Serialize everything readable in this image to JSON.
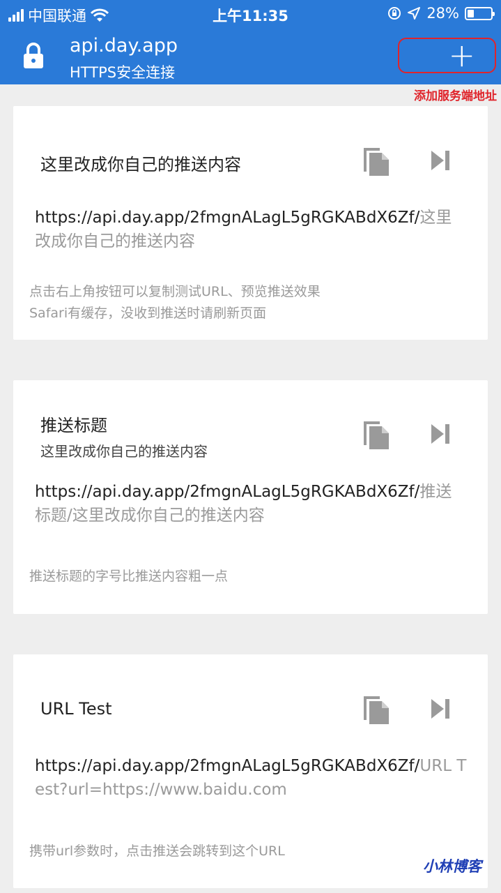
{
  "status_bar": {
    "carrier": "中国联通",
    "time": "上午11:35",
    "battery": "28%",
    "battery_level": 0.28
  },
  "header": {
    "domain": "api.day.app",
    "security": "HTTPS安全连接",
    "add_label": "+",
    "add_annotation": "添加服务端地址"
  },
  "cards": [
    {
      "title": "这里改成你自己的推送内容",
      "subtitle": "",
      "url_base": "https://api.day.app/2fmgnALagL5gRGKABdX6Zf/",
      "url_rest": "这里改成你自己的推送内容",
      "notes": [
        "点击右上角按钮可以复制测试URL、预览推送效果",
        "Safari有缓存，没收到推送时请刷新页面"
      ]
    },
    {
      "title": "推送标题",
      "subtitle": "这里改成你自己的推送内容",
      "url_base": "https://api.day.app/2fmgnALagL5gRGKABdX6Zf/",
      "url_rest": "推送标题/这里改成你自己的推送内容",
      "notes": [
        "推送标题的字号比推送内容粗一点"
      ]
    },
    {
      "title": "URL Test",
      "subtitle": "",
      "url_base": "https://api.day.app/2fmgnALagL5gRGKABdX6Zf/",
      "url_rest": "URL Test?url=https://www.baidu.com",
      "notes": [
        "携带url参数时，点击推送会跳转到这个URL"
      ]
    }
  ],
  "watermark": "小林博客",
  "colors": {
    "header_bg": "#2a7ad8",
    "annotation": "#e0242b"
  },
  "icons": [
    "lock-icon",
    "copy-icon",
    "play-next-icon",
    "wifi-icon",
    "location-icon"
  ]
}
